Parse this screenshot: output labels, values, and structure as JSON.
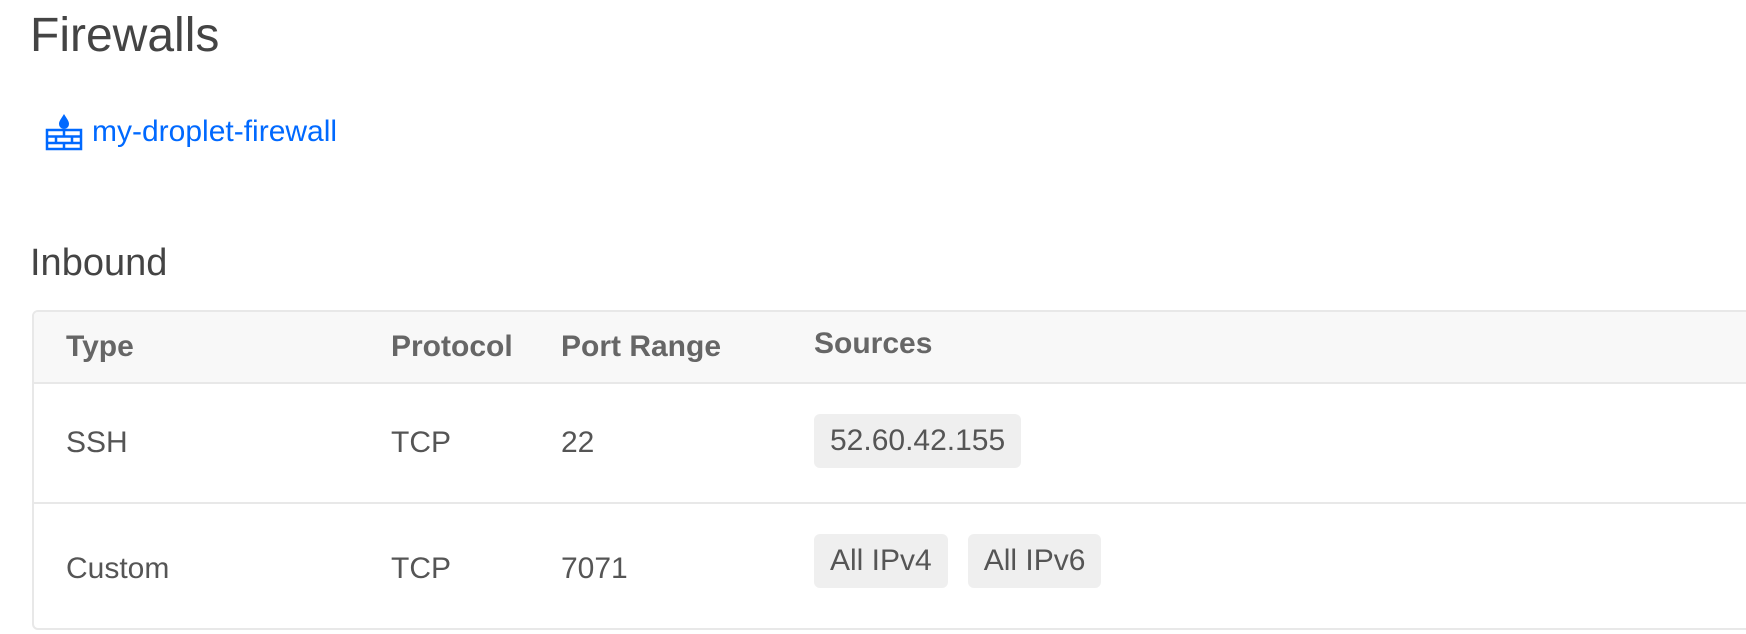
{
  "page": {
    "title": "Firewalls"
  },
  "firewall": {
    "name": "my-droplet-firewall",
    "icon": "firewall-icon",
    "link_color": "#0069ff"
  },
  "inbound": {
    "title": "Inbound",
    "columns": [
      "Type",
      "Protocol",
      "Port Range",
      "Sources"
    ],
    "rows": [
      {
        "type": "SSH",
        "protocol": "TCP",
        "port_range": "22",
        "sources": [
          "52.60.42.155"
        ]
      },
      {
        "type": "Custom",
        "protocol": "TCP",
        "port_range": "7071",
        "sources": [
          "All IPv4",
          "All IPv6"
        ]
      }
    ]
  }
}
